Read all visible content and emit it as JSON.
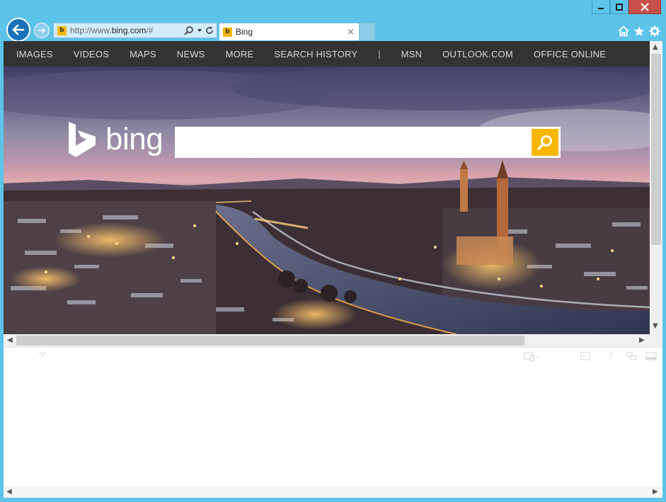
{
  "browser": {
    "address_bar": {
      "url_prefix": "http://www.",
      "url_domain": "bing.com",
      "url_suffix": "/#"
    },
    "tab": {
      "title": "Bing",
      "close": "×"
    }
  },
  "bing_nav": {
    "links": [
      "IMAGES",
      "VIDEOS",
      "MAPS",
      "NEWS",
      "MORE",
      "SEARCH HISTORY"
    ],
    "separator": "|",
    "right_links": [
      "MSN",
      "OUTLOOK.COM",
      "OFFICE ONLINE"
    ]
  },
  "logo": {
    "text": "bing"
  },
  "search": {
    "placeholder": "",
    "value": ""
  },
  "icons": {
    "back": "back-arrow-icon",
    "forward": "forward-arrow-icon",
    "search": "magnifier-icon",
    "refresh": "refresh-icon",
    "home": "home-icon",
    "favorites": "star-icon",
    "settings": "gear-icon"
  },
  "colors": {
    "frame": "#5cc3e9",
    "bing_nav_bg": "#333333",
    "search_button": "#f8b600",
    "close_button": "#c7504a"
  }
}
